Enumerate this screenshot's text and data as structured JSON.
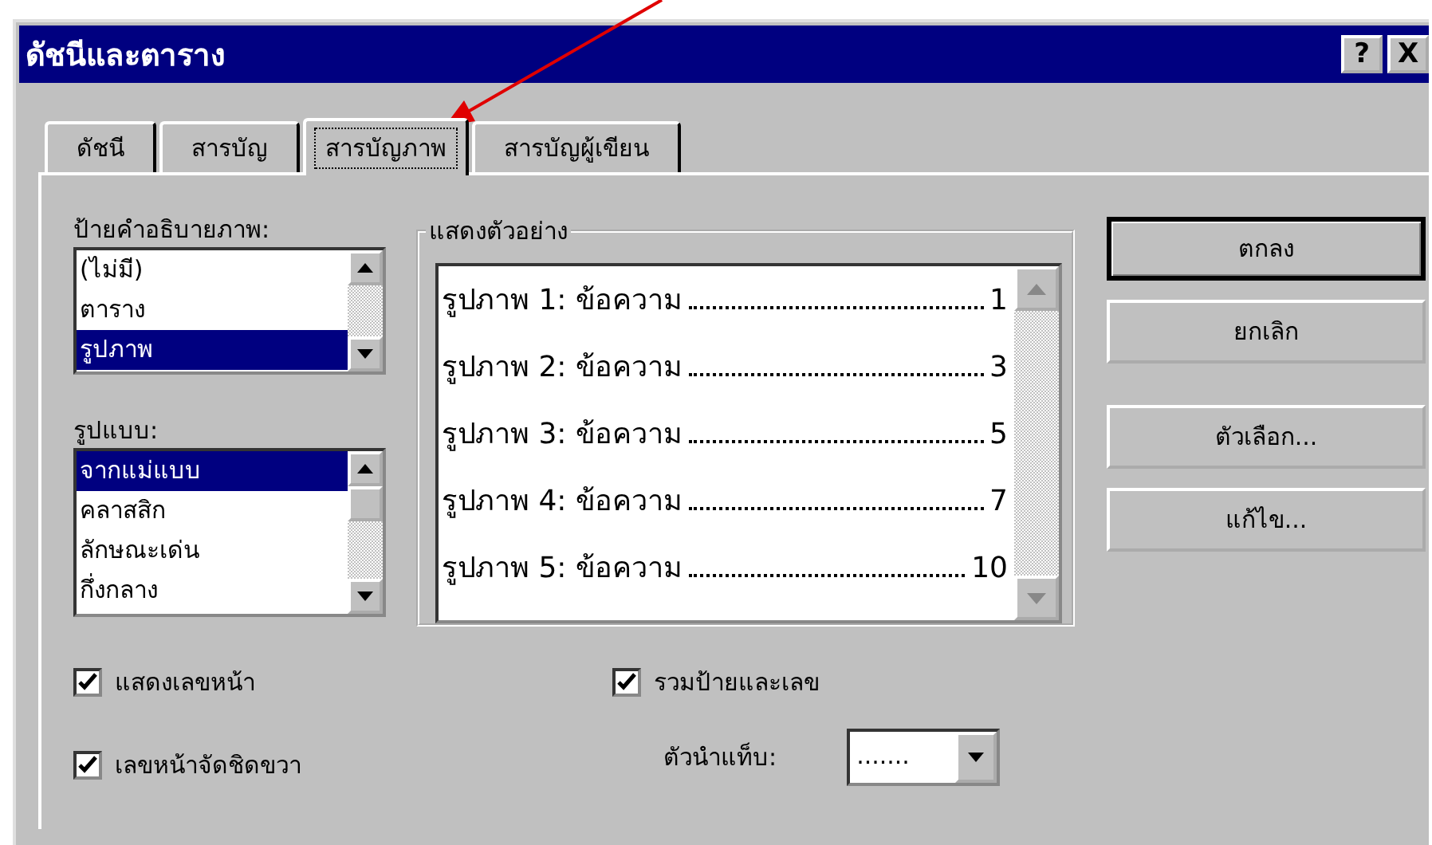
{
  "window": {
    "title": "ดัชนีและตาราง",
    "title_buttons": [
      "?",
      "X"
    ]
  },
  "tabs": [
    {
      "label": "ดัชนี",
      "selected": false
    },
    {
      "label": "สารบัญ",
      "selected": false
    },
    {
      "label": "สารบัญภาพ",
      "selected": true
    },
    {
      "label": "สารบัญผู้เขียน",
      "selected": false
    }
  ],
  "caption_label": {
    "label": "ป้ายคำอธิบายภาพ:",
    "items": [
      {
        "label": "(ไม่มี)",
        "selected": false
      },
      {
        "label": "ตาราง",
        "selected": false
      },
      {
        "label": "รูปภาพ",
        "selected": true
      }
    ]
  },
  "formats": {
    "label": "รูปแบบ:",
    "items": [
      {
        "label": "จากแม่แบบ",
        "selected": true
      },
      {
        "label": "คลาสสิก",
        "selected": false
      },
      {
        "label": "ลักษณะเด่น",
        "selected": false
      },
      {
        "label": "กึ่งกลาง",
        "selected": false
      }
    ]
  },
  "preview": {
    "label": "แสดงตัวอย่าง",
    "entries": [
      {
        "text": "รูปภาพ 1: ข้อความ",
        "page": "1"
      },
      {
        "text": "รูปภาพ 2: ข้อความ",
        "page": "3"
      },
      {
        "text": "รูปภาพ 3: ข้อความ",
        "page": "5"
      },
      {
        "text": "รูปภาพ 4: ข้อความ",
        "page": "7"
      },
      {
        "text": "รูปภาพ 5: ข้อความ",
        "page": "10"
      }
    ]
  },
  "buttons": [
    {
      "label": "ตกลง",
      "default": true
    },
    {
      "label": "ยกเลิก",
      "default": false
    },
    {
      "label": "ตัวเลือก...",
      "default": false
    },
    {
      "label": "แก้ไข...",
      "default": false
    }
  ],
  "options": [
    {
      "label": "แสดงเลขหน้า",
      "checked": true
    },
    {
      "label": "เลขหน้าจัดชิดขวา",
      "checked": true
    }
  ],
  "include_label": {
    "label": "รวมป้ายและเลข",
    "checked": true
  },
  "tab_leader": {
    "label": "ตัวนำแท็บ:",
    "value": "......."
  }
}
